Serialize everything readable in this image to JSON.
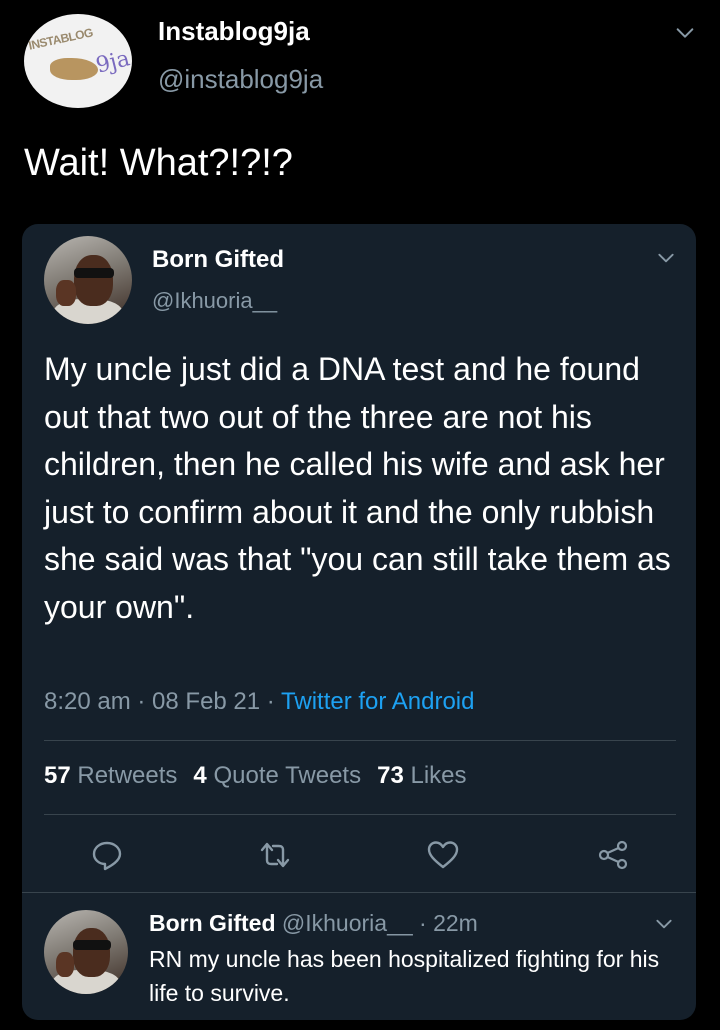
{
  "tweet": {
    "author_name": "Instablog9ja",
    "author_handle": "@instablog9ja",
    "avatar_logo_text": "INSTABLOG",
    "avatar_logo_suffix": "9ja",
    "text": "Wait! What?!?!?",
    "icons": {
      "more": "chevron-down-icon"
    }
  },
  "quoted_tweet": {
    "author_name": "Born Gifted",
    "author_handle": "@Ikhuoria__",
    "text": "My uncle just did a DNA test and he found out that two out of the three are not his children, then he called his wife and ask her just to confirm about it and the only rubbish she said was that \"you can still take them as your own\".",
    "time": "8:20 am",
    "date": "08 Feb 21",
    "separator": " · ",
    "source": "Twitter for Android",
    "stats": {
      "retweets_count": "57",
      "retweets_label": "Retweets",
      "quotes_count": "4",
      "quotes_label": "Quote Tweets",
      "likes_count": "73",
      "likes_label": "Likes"
    },
    "actions": [
      "reply-icon",
      "retweet-icon",
      "like-icon",
      "share-icon"
    ],
    "colors": {
      "card_bg": "#15202b",
      "muted": "#8899a6",
      "link": "#1da1f2",
      "divider": "#38444d"
    }
  },
  "reply": {
    "author_name": "Born Gifted",
    "author_handle": "@Ikhuoria__",
    "time_ago": " · 22m",
    "text": "RN my uncle has been hospitalized fighting for his life to survive."
  }
}
